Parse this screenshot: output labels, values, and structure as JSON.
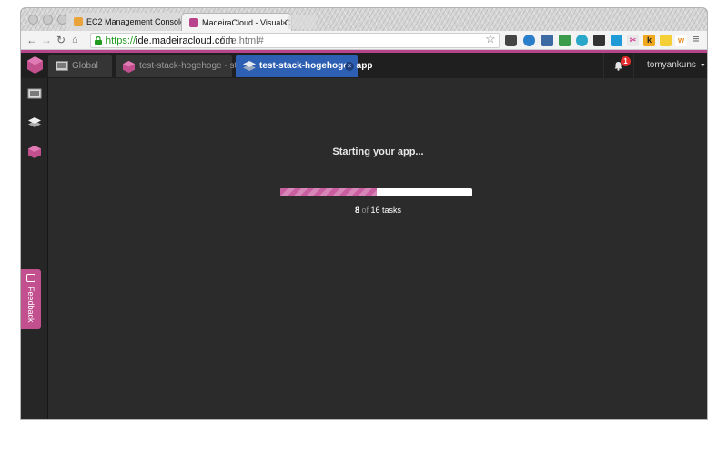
{
  "browser": {
    "tabs": [
      {
        "title": "EC2 Management Console",
        "favicon": "aws-icon",
        "active": false
      },
      {
        "title": "MadeiraCloud - Visual Clo",
        "favicon": "madeira-icon",
        "active": true
      }
    ],
    "close_glyph": "×",
    "url": {
      "scheme": "https://",
      "host": "ide.madeiracloud.com",
      "path": "/ide.html#"
    }
  },
  "app": {
    "tabs": [
      {
        "label": "Global",
        "icon": "region-icon"
      },
      {
        "label": "test-stack-hogehoge - st...",
        "icon": "stack-cube-icon"
      },
      {
        "label": "test-stack-hogehoge - app",
        "icon": "app-layers-icon",
        "active": true
      }
    ],
    "tab_close_glyph": "×",
    "notifications": {
      "count": "1"
    },
    "user": {
      "name": "tomyankuns",
      "caret": "▼"
    },
    "feedback": {
      "label": "Feedback"
    }
  },
  "main": {
    "title": "Starting your app...",
    "progress": {
      "done": 8,
      "total": 16,
      "done_text": "8",
      "of_text": "of",
      "total_text": "16 tasks"
    }
  },
  "colors": {
    "accent": "#b8458c",
    "progress": "#c95fa0",
    "active_tab": "#2d5fb2",
    "badge": "#e52c2c",
    "background": "#2b2b2b"
  }
}
